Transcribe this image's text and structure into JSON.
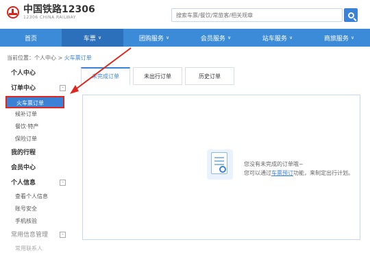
{
  "header": {
    "logo_cn": "中国铁路12306",
    "logo_en": "12306 CHINA RAILWAY",
    "search_placeholder": "搜索车票/餐饮/常旅客/相关规章"
  },
  "nav": [
    {
      "label": "首页",
      "chev": ""
    },
    {
      "label": "车票",
      "chev": "∨"
    },
    {
      "label": "团购服务",
      "chev": "∨"
    },
    {
      "label": "会员服务",
      "chev": "∨"
    },
    {
      "label": "站车服务",
      "chev": "∨"
    },
    {
      "label": "商旅服务",
      "chev": "∨"
    }
  ],
  "breadcrumb": {
    "prefix": "当前位置：个人中心 > ",
    "current": "火车票订单"
  },
  "sidebar": {
    "personal_center": "个人中心",
    "order_center": "订单中心",
    "order_items": [
      "火车票订单",
      "候补订单",
      "餐饮·特产",
      "保险订单"
    ],
    "my_trip": "我的行程",
    "member_center": "会员中心",
    "personal_info": "个人信息",
    "info_items": [
      "查看个人信息",
      "账号安全",
      "手机核验"
    ],
    "common_info": "常用信息管理",
    "common_items": [
      "常用联系人"
    ],
    "toggle": "-"
  },
  "tabs": [
    "未完成订单",
    "未出行订单",
    "历史订单"
  ],
  "empty": {
    "line1": "您没有未完成的订单哦~",
    "line2_prefix": "您可以通过",
    "line2_link": "车票预订",
    "line2_suffix": "功能，来制定出行计划。"
  },
  "colors": {
    "brand_red": "#d9251c",
    "nav_blue": "#3b8bd8",
    "accent_blue": "#3b82d6",
    "annotation_red": "#e0261e"
  },
  "icons": {
    "logo": "railway-logo-icon",
    "search": "search-icon",
    "empty": "empty-order-icon"
  }
}
